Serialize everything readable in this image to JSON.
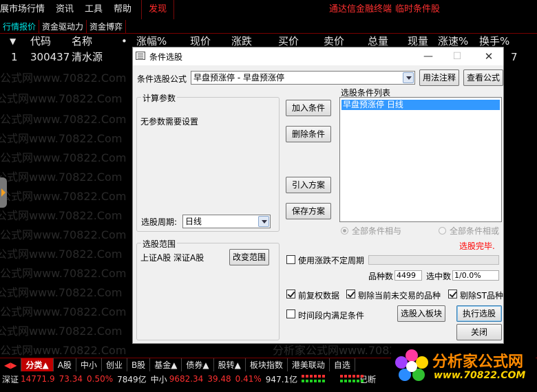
{
  "menubar": {
    "items": [
      "展市场行情",
      "资讯",
      "工具",
      "帮助"
    ],
    "discover": "发现",
    "link1": "通达信金融终端",
    "link2": "临时条件股"
  },
  "tabs": [
    "行情报价",
    "资金驱动力",
    "资金博弈"
  ],
  "table": {
    "headers": [
      "代码",
      "名称",
      "•",
      "涨幅%",
      "现价",
      "涨跌",
      "买价",
      "卖价",
      "总量",
      "现量",
      "涨速%",
      "换手%"
    ],
    "row": {
      "index": "1",
      "code": "300437",
      "name": "清水源",
      "trail": "7"
    }
  },
  "watermark": {
    "text1": "公式网www.70822.Com",
    "text2": "分析家公式网www.70822.Com"
  },
  "dialog": {
    "title": "条件选股",
    "formula_label": "条件选股公式",
    "formula_value": "早盘预涨停   - 早盘预涨停",
    "btn_usage": "用法注释",
    "btn_view": "查看公式",
    "calc_group": "计算参数",
    "no_params": "无参数需要设置",
    "btn_add": "加入条件",
    "btn_delete": "删除条件",
    "btn_import": "引入方案",
    "btn_save": "保存方案",
    "cond_list_label": "选股条件列表",
    "cond_item": "早盘预涨停   日线",
    "period_label": "选股周期:",
    "period_value": "日线",
    "radio_and": "全部条件相与",
    "radio_or": "全部条件相或",
    "status": "选股完毕.",
    "range_group": "选股范围",
    "range_value": "上证A股  深证A股",
    "btn_range": "改变范围",
    "chk_uncertain": "使用涨跌不定周期",
    "count_label": "品种数",
    "count_value": "4499",
    "selected_label": "选中数",
    "selected_value": "1/0.0%",
    "chk_restore": "前复权数据",
    "chk_no_trade": "剔除当前未交易的品种",
    "chk_st": "剔除ST品种",
    "chk_period": "时间段内满足条件",
    "btn_to_board": "选股入板块",
    "btn_execute": "执行选股",
    "btn_close": "关闭",
    "win_min": "—",
    "win_max": "☐",
    "win_close": "✕"
  },
  "bottom_tabs": [
    "分类▲",
    "A股",
    "中小",
    "创业",
    "B股",
    "基金▲",
    "债券▲",
    "股转▲",
    "板块指数",
    "港美联动",
    "自选"
  ],
  "status": {
    "sz_label": "深证",
    "sz_index": "14771.9",
    "sz_change": "73.34",
    "sz_pct": "0.50%",
    "sz_amount": "7849亿",
    "zx_label": "中小",
    "zx_index": "9682.34",
    "zx_change": "39.48",
    "zx_pct": "0.41%",
    "zx_amount": "947.1亿",
    "state": "已断"
  },
  "logo": {
    "title": "分析家公式网",
    "url": "www.70822.COM"
  },
  "colors": {
    "accent_red": "#ff3030",
    "tab_cyan": "#00e6e6",
    "select_blue": "#3399ff",
    "logo_orange": "#ff8a00",
    "logo_yellow": "#ffd400"
  }
}
